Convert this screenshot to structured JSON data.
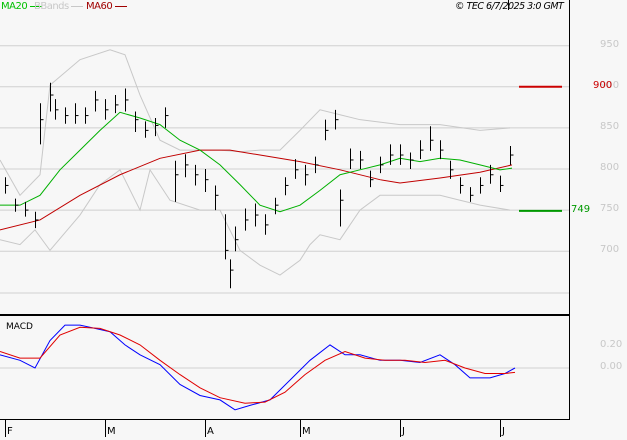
{
  "header": {
    "legend": [
      {
        "label": "MA20",
        "color": "#00c000"
      },
      {
        "label": "BBands",
        "color": "#c8c8c8"
      },
      {
        "label": "MA60",
        "color": "#a00000"
      }
    ],
    "copyright": "© TEC 6/7/2025 3:0 GMT"
  },
  "chart_data": [
    {
      "type": "ohlc",
      "title": "Price",
      "ylim": [
        640,
        980
      ],
      "yticks": [
        "950",
        "900",
        "850",
        "800",
        "750",
        "700"
      ],
      "ytick_values": [
        950,
        900,
        850,
        800,
        750,
        700
      ],
      "xticks": [
        "F",
        "M",
        "A",
        "M",
        "J",
        "J"
      ],
      "xtick_days": [
        1,
        21,
        41,
        60,
        80,
        100
      ],
      "resistance": {
        "label": "900",
        "value": 900,
        "color": "#cc0000"
      },
      "support": {
        "label": "749",
        "value": 749,
        "color": "#009900"
      },
      "bars": [
        [
          1,
          770,
          790,
          780
        ],
        [
          3,
          748,
          764,
          756
        ],
        [
          5,
          742,
          760,
          750
        ],
        [
          7,
          728,
          748,
          738
        ],
        [
          8,
          830,
          880,
          860
        ],
        [
          10,
          870,
          905,
          890
        ],
        [
          11,
          860,
          885,
          872
        ],
        [
          13,
          855,
          875,
          865
        ],
        [
          15,
          855,
          880,
          865
        ],
        [
          17,
          855,
          875,
          865
        ],
        [
          19,
          870,
          895,
          884
        ],
        [
          21,
          860,
          885,
          872
        ],
        [
          23,
          868,
          890,
          878
        ],
        [
          25,
          870,
          898,
          884
        ],
        [
          27,
          845,
          870,
          860
        ],
        [
          29,
          838,
          858,
          847
        ],
        [
          31,
          840,
          862,
          853
        ],
        [
          33,
          850,
          875,
          865
        ],
        [
          35,
          760,
          810,
          793
        ],
        [
          37,
          790,
          818,
          805
        ],
        [
          39,
          780,
          805,
          793
        ],
        [
          41,
          772,
          800,
          787
        ],
        [
          43,
          750,
          780,
          768
        ],
        [
          45,
          690,
          745,
          701
        ],
        [
          46,
          655,
          690,
          677
        ],
        [
          47,
          700,
          730,
          714
        ],
        [
          49,
          725,
          752,
          738
        ],
        [
          51,
          730,
          758,
          744
        ],
        [
          53,
          720,
          745,
          732
        ],
        [
          55,
          745,
          765,
          756
        ],
        [
          57,
          768,
          790,
          780
        ],
        [
          59,
          788,
          812,
          799
        ],
        [
          61,
          780,
          805,
          793
        ],
        [
          63,
          795,
          815,
          805
        ],
        [
          65,
          835,
          860,
          847
        ],
        [
          67,
          848,
          872,
          860
        ],
        [
          68,
          730,
          775,
          762
        ],
        [
          70,
          800,
          825,
          811
        ],
        [
          72,
          800,
          822,
          811
        ],
        [
          74,
          778,
          798,
          787
        ],
        [
          76,
          795,
          815,
          805
        ],
        [
          78,
          805,
          830,
          817
        ],
        [
          80,
          805,
          830,
          817
        ],
        [
          82,
          800,
          820,
          811
        ],
        [
          84,
          812,
          835,
          823
        ],
        [
          86,
          822,
          852,
          835
        ],
        [
          88,
          812,
          835,
          823
        ],
        [
          90,
          788,
          810,
          799
        ],
        [
          92,
          770,
          790,
          780
        ],
        [
          94,
          760,
          778,
          768
        ],
        [
          96,
          770,
          790,
          780
        ],
        [
          98,
          782,
          805,
          793
        ],
        [
          100,
          772,
          792,
          780
        ],
        [
          102,
          805,
          828,
          817
        ]
      ],
      "ma20": [
        [
          0,
          756
        ],
        [
          4,
          756
        ],
        [
          8,
          768
        ],
        [
          12,
          799
        ],
        [
          16,
          823
        ],
        [
          20,
          847
        ],
        [
          24,
          869
        ],
        [
          28,
          862
        ],
        [
          32,
          854
        ],
        [
          36,
          835
        ],
        [
          40,
          823
        ],
        [
          44,
          805
        ],
        [
          48,
          781
        ],
        [
          52,
          756
        ],
        [
          56,
          748
        ],
        [
          60,
          756
        ],
        [
          64,
          774
        ],
        [
          68,
          793
        ],
        [
          72,
          799
        ],
        [
          76,
          805
        ],
        [
          80,
          813
        ],
        [
          84,
          809
        ],
        [
          88,
          813
        ],
        [
          92,
          811
        ],
        [
          96,
          805
        ],
        [
          100,
          799
        ],
        [
          102.4,
          801
        ]
      ],
      "ma60": [
        [
          0,
          726
        ],
        [
          8,
          738
        ],
        [
          16,
          768
        ],
        [
          24,
          793
        ],
        [
          32,
          813
        ],
        [
          40,
          823
        ],
        [
          46,
          823
        ],
        [
          52,
          817
        ],
        [
          60,
          809
        ],
        [
          68,
          799
        ],
        [
          76,
          787
        ],
        [
          80,
          783
        ],
        [
          88,
          789
        ],
        [
          96,
          796
        ],
        [
          102.4,
          805
        ]
      ],
      "bb_upper": [
        [
          0,
          811
        ],
        [
          4,
          768
        ],
        [
          8,
          793
        ],
        [
          10,
          902
        ],
        [
          16,
          933
        ],
        [
          22,
          945
        ],
        [
          25,
          939
        ],
        [
          28,
          890
        ],
        [
          32,
          835
        ],
        [
          36,
          823
        ],
        [
          40,
          823
        ],
        [
          44,
          823
        ],
        [
          48,
          821
        ],
        [
          52,
          823
        ],
        [
          56,
          823
        ],
        [
          60,
          847
        ],
        [
          64,
          872
        ],
        [
          68,
          866
        ],
        [
          72,
          860
        ],
        [
          80,
          854
        ],
        [
          88,
          854
        ],
        [
          96,
          847
        ],
        [
          102,
          850
        ]
      ],
      "bb_lower": [
        [
          0,
          714
        ],
        [
          4,
          708
        ],
        [
          7,
          726
        ],
        [
          10,
          701
        ],
        [
          16,
          744
        ],
        [
          20,
          781
        ],
        [
          24,
          799
        ],
        [
          28,
          750
        ],
        [
          30,
          799
        ],
        [
          34,
          762
        ],
        [
          40,
          750
        ],
        [
          44,
          750
        ],
        [
          48,
          701
        ],
        [
          52,
          683
        ],
        [
          56,
          671
        ],
        [
          60,
          689
        ],
        [
          62,
          708
        ],
        [
          64,
          720
        ],
        [
          68,
          714
        ],
        [
          72,
          750
        ],
        [
          76,
          768
        ],
        [
          80,
          768
        ],
        [
          88,
          768
        ],
        [
          92,
          762
        ],
        [
          96,
          756
        ],
        [
          102,
          750
        ]
      ]
    },
    {
      "type": "line",
      "title": "MACD",
      "ylim": [
        -0.47,
        0.48
      ],
      "yticks": [
        "0.20",
        "0.00"
      ],
      "ytick_values": [
        0.2,
        0.0
      ],
      "macd": [
        [
          0,
          0.12
        ],
        [
          4,
          0.07
        ],
        [
          7,
          0
        ],
        [
          10,
          0.25
        ],
        [
          13,
          0.39
        ],
        [
          16,
          0.39
        ],
        [
          19,
          0.36
        ],
        [
          22,
          0.33
        ],
        [
          25,
          0.21
        ],
        [
          28,
          0.12
        ],
        [
          32,
          0.03
        ],
        [
          36,
          -0.15
        ],
        [
          40,
          -0.25
        ],
        [
          44,
          -0.29
        ],
        [
          47,
          -0.38
        ],
        [
          50,
          -0.34
        ],
        [
          54,
          -0.29
        ],
        [
          58,
          -0.11
        ],
        [
          62,
          0.07
        ],
        [
          66,
          0.21
        ],
        [
          69,
          0.12
        ],
        [
          72,
          0.12
        ],
        [
          76,
          0.07
        ],
        [
          80,
          0.07
        ],
        [
          84,
          0.05
        ],
        [
          88,
          0.12
        ],
        [
          91,
          0.03
        ],
        [
          94,
          -0.09
        ],
        [
          98,
          -0.09
        ],
        [
          101,
          -0.05
        ],
        [
          103,
          0
        ]
      ],
      "signal": [
        [
          0,
          0.15
        ],
        [
          4,
          0.09
        ],
        [
          8,
          0.09
        ],
        [
          12,
          0.3
        ],
        [
          16,
          0.37
        ],
        [
          20,
          0.36
        ],
        [
          24,
          0.3
        ],
        [
          28,
          0.21
        ],
        [
          32,
          0.07
        ],
        [
          36,
          -0.06
        ],
        [
          40,
          -0.18
        ],
        [
          44,
          -0.27
        ],
        [
          49,
          -0.32
        ],
        [
          53,
          -0.31
        ],
        [
          57,
          -0.22
        ],
        [
          61,
          -0.06
        ],
        [
          65,
          0.07
        ],
        [
          69,
          0.15
        ],
        [
          73,
          0.09
        ],
        [
          77,
          0.07
        ],
        [
          81,
          0.07
        ],
        [
          85,
          0.05
        ],
        [
          89,
          0.07
        ],
        [
          93,
          0
        ],
        [
          97,
          -0.05
        ],
        [
          101,
          -0.05
        ],
        [
          103,
          -0.04
        ]
      ]
    }
  ]
}
